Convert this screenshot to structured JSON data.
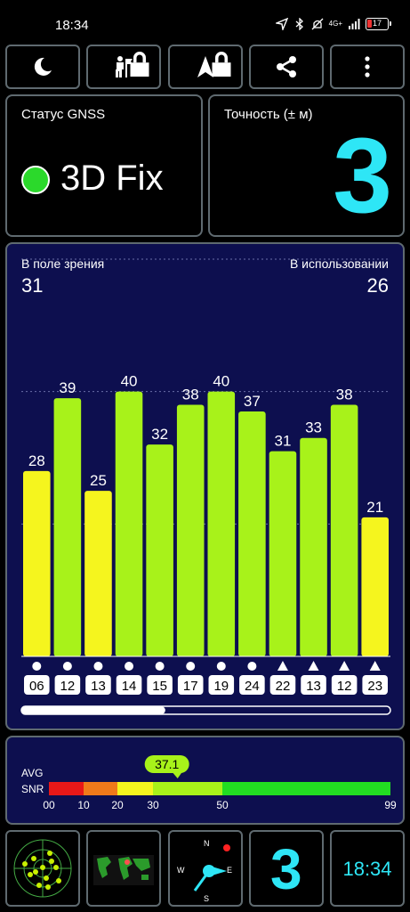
{
  "status_bar": {
    "time": "18:34",
    "network": "4G+",
    "battery": "17"
  },
  "toolbar": {
    "icons": [
      "moon-icon",
      "hiker-icon",
      "navigation-arrow-icon",
      "share-icon",
      "more-vertical-icon"
    ]
  },
  "gnss_status": {
    "title": "Статус GNSS",
    "value": "3D Fix",
    "indicator_color": "#2bd92b"
  },
  "accuracy": {
    "title": "Точность (± м)",
    "value": "3",
    "color": "#2ee6f6"
  },
  "satellites": {
    "in_view_label": "В поле зрения",
    "in_view": "31",
    "in_use_label": "В использовании",
    "in_use": "26"
  },
  "chart_data": {
    "type": "bar",
    "categories": [
      "06",
      "12",
      "13",
      "14",
      "15",
      "17",
      "19",
      "24",
      "22",
      "13",
      "12",
      "23"
    ],
    "values": [
      28,
      39,
      25,
      40,
      32,
      38,
      40,
      37,
      31,
      33,
      38,
      21
    ],
    "markers": [
      "circle",
      "circle",
      "circle",
      "circle",
      "circle",
      "circle",
      "circle",
      "circle",
      "triangle",
      "triangle",
      "triangle",
      "triangle"
    ],
    "ylim": [
      0,
      60
    ],
    "grid": true,
    "colors": {
      "low": "#f5f51e",
      "high": "#a8f21a"
    },
    "scroll_fraction": 0.39
  },
  "snr": {
    "label_top": "AVG",
    "label_bottom": "SNR",
    "average": "37.1",
    "average_value": 37.1,
    "segments": [
      {
        "from": 0,
        "to": 10,
        "color": "#e81818"
      },
      {
        "from": 10,
        "to": 20,
        "color": "#f07a1a"
      },
      {
        "from": 20,
        "to": 30,
        "color": "#f5f51e"
      },
      {
        "from": 30,
        "to": 50,
        "color": "#a8f21a"
      },
      {
        "from": 50,
        "to": 99,
        "color": "#22dd22"
      }
    ],
    "ticks": [
      "00",
      "10",
      "20",
      "30",
      "50",
      "99"
    ]
  },
  "bottom_bar": {
    "satellites_in_use": "3",
    "clock": "18:34",
    "compass": {
      "n": "N",
      "w": "W",
      "e": "E",
      "s": "S"
    }
  }
}
